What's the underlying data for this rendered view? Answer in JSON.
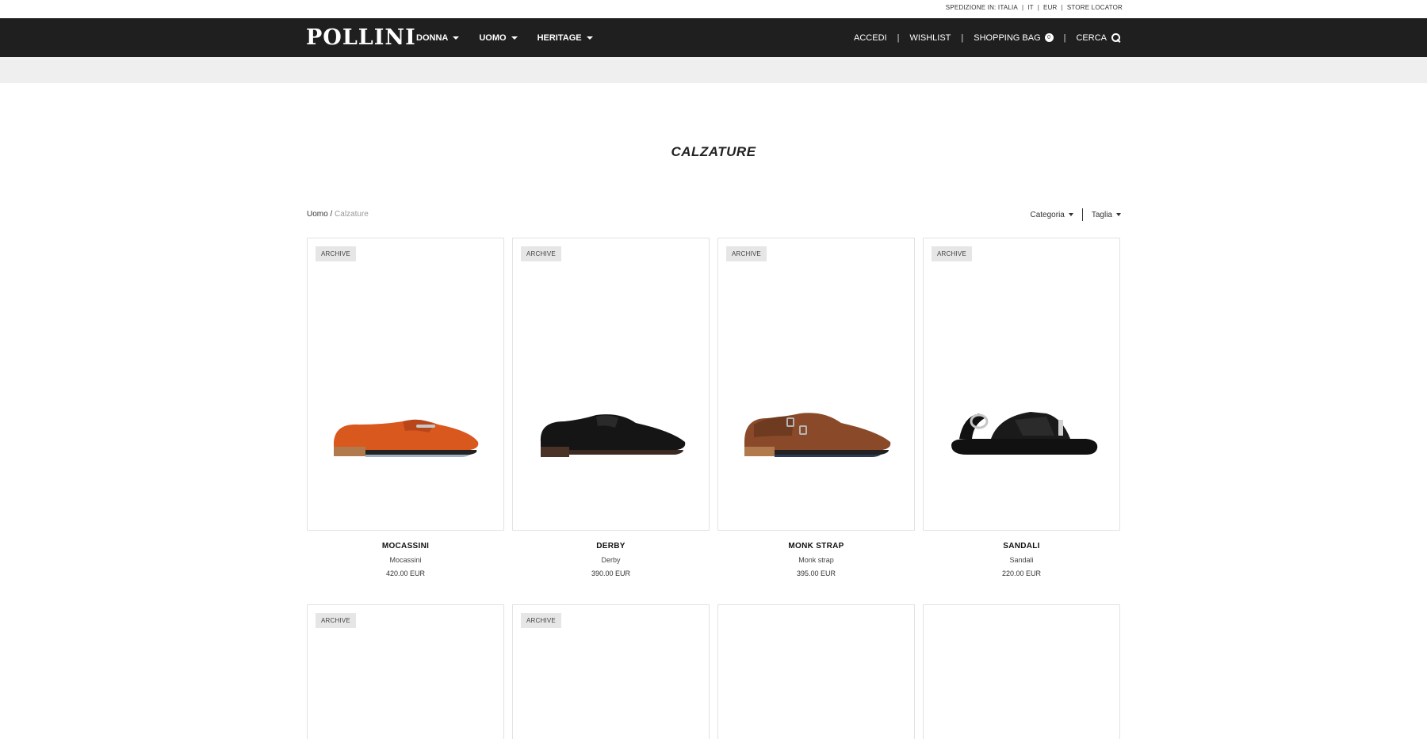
{
  "utility": {
    "shipping": "SPEDIZIONE IN: ITALIA",
    "language": "IT",
    "currency": "EUR",
    "store_locator": "STORE LOCATOR"
  },
  "header": {
    "logo": "POLLINI",
    "nav": [
      "DONNA",
      "UOMO",
      "HERITAGE"
    ],
    "login": "ACCEDI",
    "wishlist": "WISHLIST",
    "bag": "SHOPPING BAG",
    "bag_count": "0",
    "search": "CERCA"
  },
  "page": {
    "title": "CALZATURE"
  },
  "breadcrumb": {
    "parent": "Uomo",
    "separator": "/",
    "current": "Calzature"
  },
  "filters": {
    "category": "Categoria",
    "size": "Taglia"
  },
  "products": [
    {
      "badge": "ARCHIVE",
      "name": "MOCASSINI",
      "subtitle": "Mocassini",
      "price": "420.00 EUR",
      "color": "#d9581e",
      "style": "loafer"
    },
    {
      "badge": "ARCHIVE",
      "name": "DERBY",
      "subtitle": "Derby",
      "price": "390.00 EUR",
      "color": "#151515",
      "style": "derby"
    },
    {
      "badge": "ARCHIVE",
      "name": "MONK STRAP",
      "subtitle": "Monk strap",
      "price": "395.00 EUR",
      "color": "#8a4a2a",
      "style": "monk"
    },
    {
      "badge": "ARCHIVE",
      "name": "SANDALI",
      "subtitle": "Sandali",
      "price": "220.00 EUR",
      "color": "#111111",
      "style": "sandal"
    }
  ],
  "products_row2": [
    {
      "badge": "ARCHIVE"
    },
    {
      "badge": "ARCHIVE"
    },
    {
      "badge": ""
    },
    {
      "badge": ""
    }
  ],
  "colors": {
    "header_bg": "#1f1f1f",
    "band_bg": "#efefef",
    "badge_bg": "#e6e6e6"
  }
}
